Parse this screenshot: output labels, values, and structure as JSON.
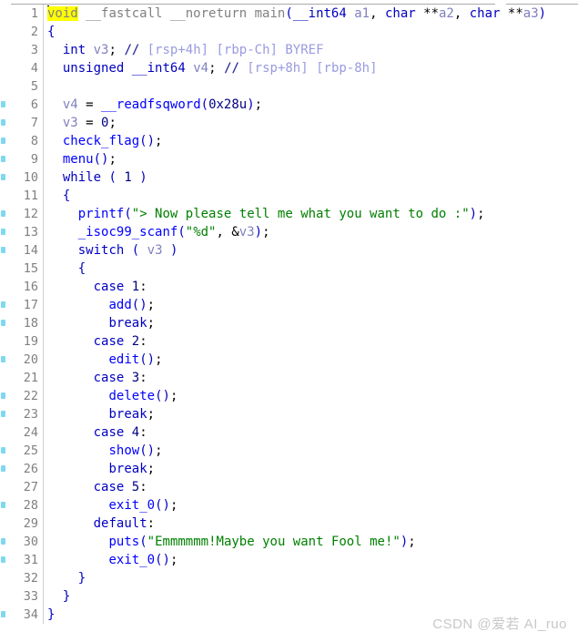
{
  "app": {
    "name": "IDA Pro Hex-Rays pseudocode view",
    "watermark": "CSDN @爱若 AI_ruo"
  },
  "editor": {
    "first_line": 1,
    "last_line": 34,
    "total_lines": 34,
    "cursor_line": 1,
    "selection_text": "void",
    "highlight_color": "#ffff00",
    "gutter_marker_color": "#7fd8f0",
    "background": "#ffffff",
    "line_number_color": "#808080"
  },
  "colors": {
    "keyword": "#0000c0",
    "function": "#0000ff",
    "variable": "#8080c0",
    "string": "#008000",
    "number": "#000080",
    "comment": "#9a9ae0",
    "prototype": "#808080",
    "watermark": "#c8c8c8"
  },
  "lines": [
    {
      "n": 1,
      "marker": false,
      "text": "void __fastcall __noreturn main(__int64 a1, char **a2, char **a3)"
    },
    {
      "n": 2,
      "marker": false,
      "text": "{"
    },
    {
      "n": 3,
      "marker": false,
      "text": "  int v3; // [rsp+4h] [rbp-Ch] BYREF"
    },
    {
      "n": 4,
      "marker": false,
      "text": "  unsigned __int64 v4; // [rsp+8h] [rbp-8h]"
    },
    {
      "n": 5,
      "marker": false,
      "text": ""
    },
    {
      "n": 6,
      "marker": true,
      "text": "  v4 = __readfsqword(0x28u);"
    },
    {
      "n": 7,
      "marker": true,
      "text": "  v3 = 0;"
    },
    {
      "n": 8,
      "marker": true,
      "text": "  check_flag();"
    },
    {
      "n": 9,
      "marker": true,
      "text": "  menu();"
    },
    {
      "n": 10,
      "marker": true,
      "text": "  while ( 1 )"
    },
    {
      "n": 11,
      "marker": false,
      "text": "  {"
    },
    {
      "n": 12,
      "marker": true,
      "text": "    printf(\"> Now please tell me what you want to do :\");"
    },
    {
      "n": 13,
      "marker": true,
      "text": "    _isoc99_scanf(\"%d\", &v3);"
    },
    {
      "n": 14,
      "marker": true,
      "text": "    switch ( v3 )"
    },
    {
      "n": 15,
      "marker": false,
      "text": "    {"
    },
    {
      "n": 16,
      "marker": false,
      "text": "      case 1:"
    },
    {
      "n": 17,
      "marker": true,
      "text": "        add();"
    },
    {
      "n": 18,
      "marker": true,
      "text": "        break;"
    },
    {
      "n": 19,
      "marker": false,
      "text": "      case 2:"
    },
    {
      "n": 20,
      "marker": true,
      "text": "        edit();"
    },
    {
      "n": 21,
      "marker": false,
      "text": "      case 3:"
    },
    {
      "n": 22,
      "marker": true,
      "text": "        delete();"
    },
    {
      "n": 23,
      "marker": true,
      "text": "        break;"
    },
    {
      "n": 24,
      "marker": false,
      "text": "      case 4:"
    },
    {
      "n": 25,
      "marker": true,
      "text": "        show();"
    },
    {
      "n": 26,
      "marker": true,
      "text": "        break;"
    },
    {
      "n": 27,
      "marker": false,
      "text": "      case 5:"
    },
    {
      "n": 28,
      "marker": true,
      "text": "        exit_0();"
    },
    {
      "n": 29,
      "marker": false,
      "text": "      default:"
    },
    {
      "n": 30,
      "marker": true,
      "text": "        puts(\"Emmmmmm!Maybe you want Fool me!\");"
    },
    {
      "n": 31,
      "marker": true,
      "text": "        exit_0();"
    },
    {
      "n": 32,
      "marker": false,
      "text": "    }"
    },
    {
      "n": 33,
      "marker": false,
      "text": "  }"
    },
    {
      "n": 34,
      "marker": true,
      "text": "}"
    }
  ],
  "line_numbers": {
    "1": "1",
    "2": "2",
    "3": "3",
    "4": "4",
    "5": "5",
    "6": "6",
    "7": "7",
    "8": "8",
    "9": "9",
    "10": "10",
    "11": "11",
    "12": "12",
    "13": "13",
    "14": "14",
    "15": "15",
    "16": "16",
    "17": "17",
    "18": "18",
    "19": "19",
    "20": "20",
    "21": "21",
    "22": "22",
    "23": "23",
    "24": "24",
    "25": "25",
    "26": "26",
    "27": "27",
    "28": "28",
    "29": "29",
    "30": "30",
    "31": "31",
    "32": "32",
    "33": "33",
    "34": "34"
  }
}
